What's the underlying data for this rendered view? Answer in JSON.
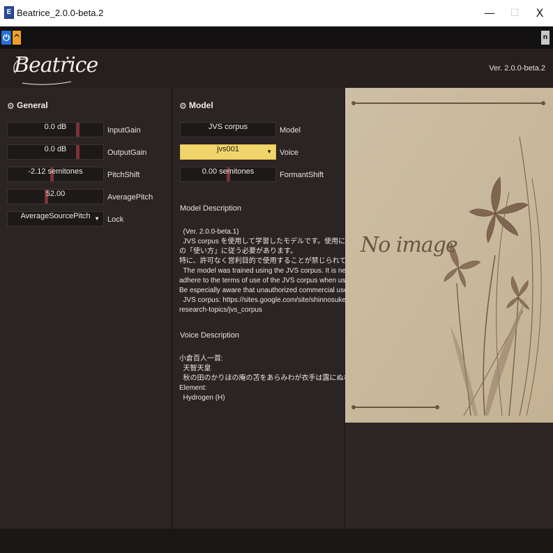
{
  "window": {
    "title": "Beatrice_2.0.0-beta.2",
    "icon_text": "E",
    "min_glyph": "—",
    "max_glyph": "☐",
    "close_glyph": "X"
  },
  "toolbar": {
    "power_glyph": "⏻",
    "up_glyph": "^",
    "right_glyph": "n"
  },
  "header": {
    "logo": "Beatrice",
    "version": "Ver. 2.0.0-beta.2"
  },
  "general": {
    "title": "General",
    "controls": [
      {
        "value": "0.0 dB",
        "label": "InputGain",
        "level": 0.74
      },
      {
        "value": "0.0 dB",
        "label": "OutputGain",
        "level": 0.74
      },
      {
        "value": "-2.12 semitones",
        "label": "PitchShift",
        "level": 0.46
      },
      {
        "value": "52.00",
        "label": "AveragePitch",
        "level": 0.4
      }
    ],
    "lock": {
      "value": "AverageSourcePitch",
      "label": "Lock",
      "arrow": "▼"
    }
  },
  "model": {
    "title": "Model",
    "model_select": {
      "value": "JVS corpus",
      "label": "Model"
    },
    "voice_select": {
      "value": "jvs001",
      "label": "Voice",
      "arrow": "▼"
    },
    "formant": {
      "value": "0.00 semitones",
      "label": "FormantShift",
      "level": 0.5
    },
    "model_description_title": "Model Description",
    "model_description": "  (Ver. 2.0.0-beta.1)\n  JVS corpus を使用して学習したモデルです。使用に際しては JVS corpus\nの「使い方」に従う必要があります。\n特に、許可なく営利目的で使用することが禁じられている点にご注意ください。\n  The model was trained using the JVS corpus. It is necessary to\nadhere to the terms of use of the JVS corpus when using the model.\nBe especially aware that unauthorized commercial use is prohibited.\n  JVS corpus: https://sites.google.com/site/shinnosuketakamichi/\nresearch-topics/jvs_corpus",
    "voice_description_title": "Voice Description",
    "voice_description": "小倉百人一首:\n  天智天皇\n  秋の田のかりほの庵の苫をあらみわが衣手は露にぬれつつ\nElement:\n  Hydrogen (H)"
  },
  "image": {
    "placeholder": "No image"
  },
  "colors": {
    "panel": "#2a2424",
    "slider_marker": "#7c3236",
    "voice_highlight": "#f2d56a",
    "image_bg": "#c9b99d",
    "power_blue": "#2870d8",
    "up_orange": "#f0a020"
  }
}
